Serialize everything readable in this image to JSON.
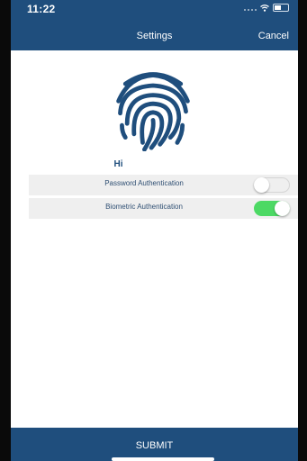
{
  "status_bar": {
    "time": "11:22"
  },
  "nav": {
    "title": "Settings",
    "cancel_label": "Cancel"
  },
  "greeting": "Hi",
  "settings": [
    {
      "label": "Password Authentication",
      "enabled": false
    },
    {
      "label": "Biometric Authentication",
      "enabled": true
    }
  ],
  "footer": {
    "submit_label": "SUBMIT"
  },
  "colors": {
    "brand": "#1f4e7d",
    "toggle_on": "#4cd964",
    "row_bg": "#efefef"
  },
  "icons": {
    "hero": "fingerprint-icon"
  }
}
